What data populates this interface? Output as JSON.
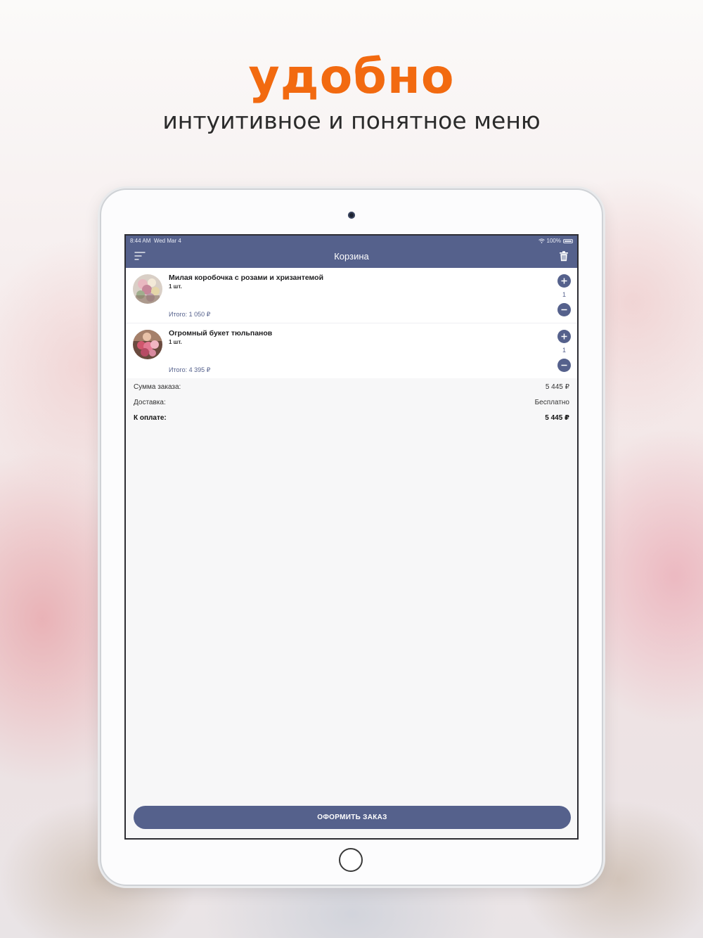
{
  "promo": {
    "headline": "удобно",
    "subline": "интуитивное и понятное меню"
  },
  "status_bar": {
    "time": "8:44 AM",
    "date": "Wed Mar 4",
    "battery": "100%"
  },
  "navbar": {
    "title": "Корзина",
    "left_icon": "menu-icon",
    "right_icon": "trash-icon"
  },
  "cart": {
    "items": [
      {
        "name": "Милая коробочка с розами и хризантемой",
        "qty_label": "1 шт.",
        "total": "Итого: 1 050 ₽",
        "quantity": "1"
      },
      {
        "name": "Огромный букет тюльпанов",
        "qty_label": "1 шт.",
        "total": "Итого: 4 395 ₽",
        "quantity": "1"
      }
    ]
  },
  "summary": {
    "order_sum_label": "Сумма заказа:",
    "order_sum_value": "5 445 ₽",
    "delivery_label": "Доставка:",
    "delivery_value": "Бесплатно",
    "to_pay_label": "К оплате:",
    "to_pay_value": "5 445 ₽"
  },
  "checkout": {
    "label": "ОФОРМИТЬ ЗАКАЗ"
  },
  "colors": {
    "accent_orange": "#f26a10",
    "brand_navy": "#55618c"
  }
}
